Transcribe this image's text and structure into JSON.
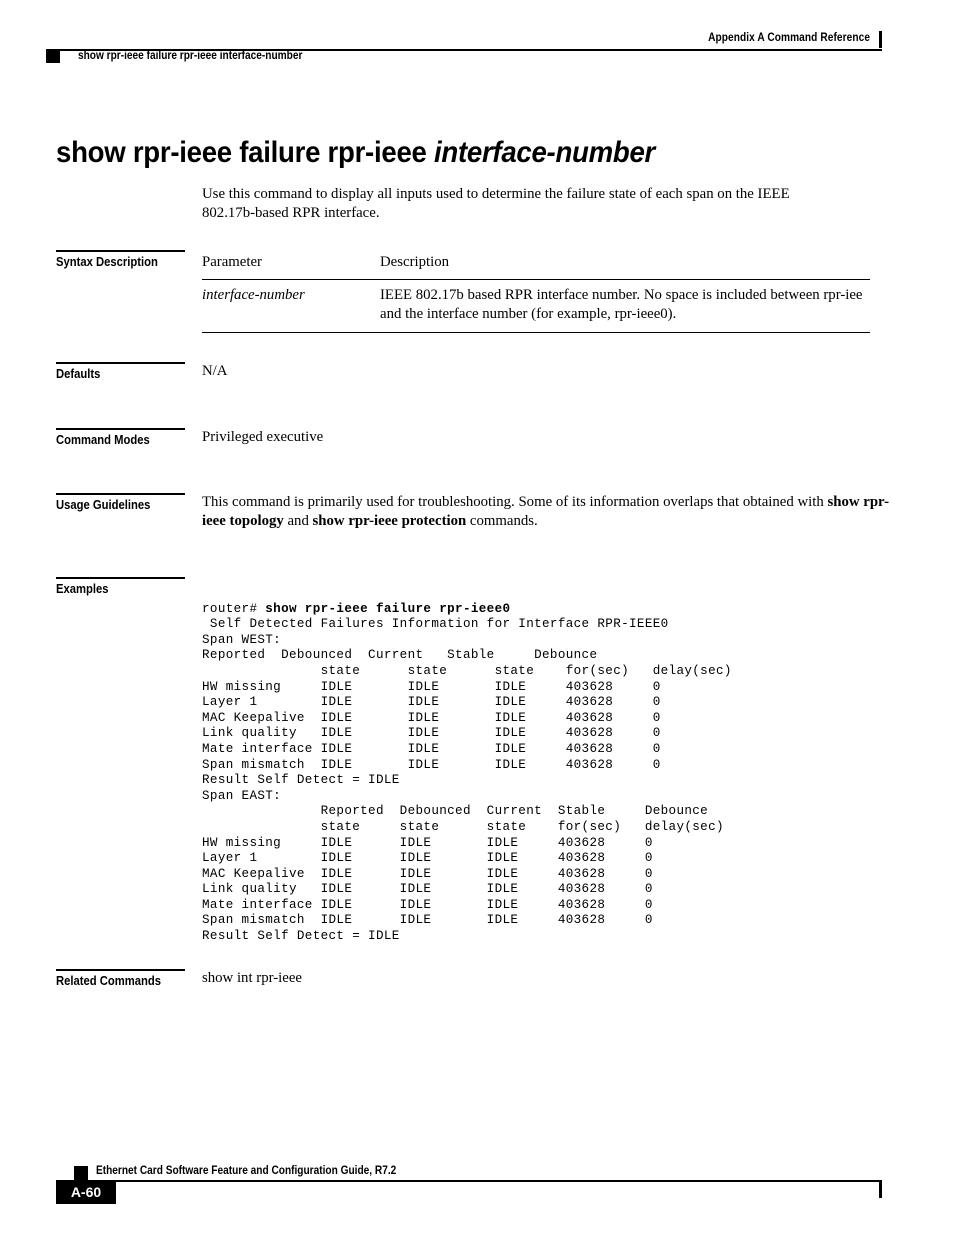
{
  "header": {
    "right_text": "Appendix A Command Reference",
    "left_text": "show rpr-ieee failure rpr-ieee interface-number"
  },
  "title": {
    "main": "show rpr-ieee failure rpr-ieee ",
    "param": "interface-number"
  },
  "intro": "Use this command to display all inputs used to determine the failure state of each span on the IEEE 802.17b-based RPR interface.",
  "syntax": {
    "label": "Syntax Description",
    "columns": [
      "Parameter",
      "Description"
    ],
    "rows": [
      {
        "parameter": "interface-number",
        "description": "IEEE 802.17b based RPR interface number. No space is included between rpr-iee and the interface number (for example, rpr-ieee0)."
      }
    ]
  },
  "defaults": {
    "label": "Defaults",
    "value": "N/A"
  },
  "command_modes": {
    "label": "Command Modes",
    "value": "Privileged executive"
  },
  "usage": {
    "label": "Usage Guidelines",
    "text_before": "This command is primarily used for troubleshooting. Some of its information overlaps that obtained with ",
    "bold_1": "show rpr-ieee topology",
    "text_middle": " and ",
    "bold_2": "show rpr-ieee protection",
    "text_after": " commands."
  },
  "examples": {
    "label": "Examples",
    "prompt": "router# ",
    "command": "show rpr-ieee failure rpr-ieee0",
    "output": " Self Detected Failures Information for Interface RPR-IEEE0\nSpan WEST:\nReported  Debounced  Current   Stable     Debounce\n               state      state      state    for(sec)   delay(sec)\nHW missing     IDLE       IDLE       IDLE     403628     0\nLayer 1        IDLE       IDLE       IDLE     403628     0\nMAC Keepalive  IDLE       IDLE       IDLE     403628     0\nLink quality   IDLE       IDLE       IDLE     403628     0\nMate interface IDLE       IDLE       IDLE     403628     0\nSpan mismatch  IDLE       IDLE       IDLE     403628     0\nResult Self Detect = IDLE\nSpan EAST:\n               Reported  Debounced  Current  Stable     Debounce\n               state     state      state    for(sec)   delay(sec)\nHW missing     IDLE      IDLE       IDLE     403628     0\nLayer 1        IDLE      IDLE       IDLE     403628     0\nMAC Keepalive  IDLE      IDLE       IDLE     403628     0\nLink quality   IDLE      IDLE       IDLE     403628     0\nMate interface IDLE      IDLE       IDLE     403628     0\nSpan mismatch  IDLE      IDLE       IDLE     403628     0\nResult Self Detect = IDLE"
  },
  "related": {
    "label": "Related Commands",
    "value": "show int rpr-ieee"
  },
  "footer": {
    "guide_text": "Ethernet Card Software Feature and Configuration Guide, R7.2",
    "page_number": "A-60"
  }
}
